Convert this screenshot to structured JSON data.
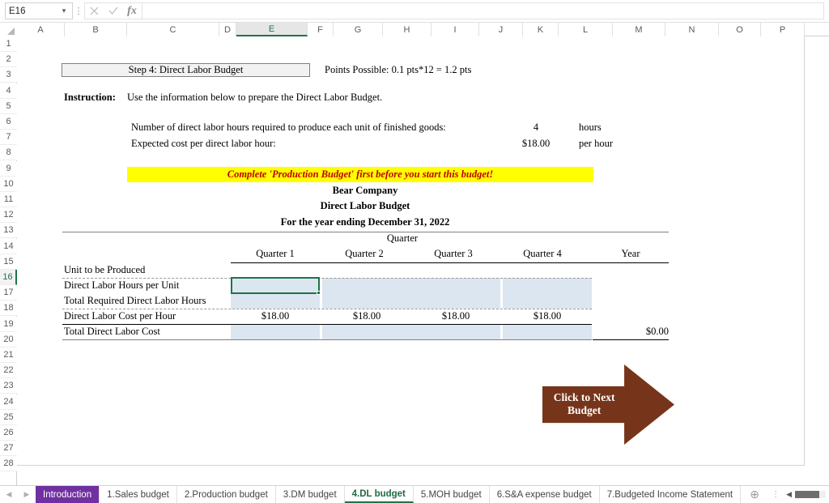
{
  "formula_bar": {
    "name_box_value": "E16",
    "formula_value": "",
    "cancel_icon": "cancel-x-icon",
    "enter_icon": "enter-check-icon",
    "fx_label": "fx"
  },
  "grid": {
    "columns": [
      "A",
      "B",
      "C",
      "D",
      "E",
      "F",
      "G",
      "H",
      "I",
      "J",
      "K",
      "L",
      "M",
      "N",
      "O",
      "P"
    ],
    "selected_column": "E",
    "rows": [
      1,
      2,
      3,
      4,
      5,
      6,
      7,
      8,
      9,
      10,
      11,
      12,
      13,
      14,
      15,
      16,
      17,
      18,
      19,
      20,
      21,
      22,
      23,
      24,
      25,
      26,
      27,
      28
    ],
    "selected_row": 16,
    "selected_cell": "E16"
  },
  "sheet": {
    "step_title": "Step 4: Direct Labor Budget",
    "points_possible": "Points Possible: 0.1 pts*12 = 1.2 pts",
    "instruction_label": "Instruction:",
    "instruction_text": "Use the information below to prepare the Direct Labor Budget.",
    "assumptions": [
      {
        "label": "Number of direct labor hours required to produce each unit of finished goods:",
        "value": "4",
        "unit": "hours"
      },
      {
        "label": "Expected cost per direct labor hour:",
        "value": "$18.00",
        "unit": "per hour"
      }
    ],
    "warning_banner": "Complete 'Production Budget' first before you start this budget!",
    "report_title": {
      "company": "Bear Company",
      "statement": "Direct Labor Budget",
      "period": "For the year ending December 31, 2022"
    },
    "table": {
      "group_header": "Quarter",
      "column_headers": [
        "Quarter 1",
        "Quarter 2",
        "Quarter 3",
        "Quarter 4",
        "Year"
      ],
      "rows": [
        {
          "label": "Unit to be Produced",
          "values": [
            "",
            "",
            "",
            "",
            ""
          ],
          "input_cells": [
            false,
            false,
            false,
            false,
            false
          ]
        },
        {
          "label": "Direct Labor Hours per Unit",
          "values": [
            "",
            "",
            "",
            "",
            ""
          ],
          "input_cells": [
            true,
            true,
            true,
            true,
            false
          ]
        },
        {
          "label": "Total Required Direct Labor Hours",
          "values": [
            "",
            "",
            "",
            "",
            ""
          ],
          "input_cells": [
            true,
            true,
            true,
            true,
            false
          ]
        },
        {
          "label": "Direct Labor Cost per Hour",
          "values": [
            "$18.00",
            "$18.00",
            "$18.00",
            "$18.00",
            ""
          ],
          "input_cells": [
            false,
            false,
            false,
            false,
            false
          ]
        },
        {
          "label": "Total Direct Labor Cost",
          "values": [
            "",
            "",
            "",
            "",
            "$0.00"
          ],
          "input_cells": [
            true,
            true,
            true,
            true,
            false
          ]
        }
      ]
    },
    "next_button": {
      "line1": "Click to Next",
      "line2": "Budget"
    }
  },
  "tabs": {
    "prev_icon": "chevron-left-icon",
    "next_icon": "chevron-right-icon",
    "add_icon": "plus-circle-icon",
    "more_icon": "more-vertical-icon",
    "items": [
      {
        "label": "Introduction",
        "style": "purple"
      },
      {
        "label": "1.Sales budget",
        "style": "normal"
      },
      {
        "label": "2.Production budget",
        "style": "normal"
      },
      {
        "label": "3.DM budget",
        "style": "normal"
      },
      {
        "label": "4.DL budget",
        "style": "active"
      },
      {
        "label": "5.MOH budget",
        "style": "normal"
      },
      {
        "label": "6.S&A expense budget",
        "style": "normal"
      },
      {
        "label": "7.Budgeted Income Statement",
        "style": "normal"
      }
    ]
  },
  "colors": {
    "accent_green": "#217346",
    "input_cell_blue": "#dce6f1",
    "warning_yellow": "#ffff00",
    "warning_red": "#c00000",
    "arrow_brown": "#76351a",
    "tab_purple": "#7030a0"
  }
}
